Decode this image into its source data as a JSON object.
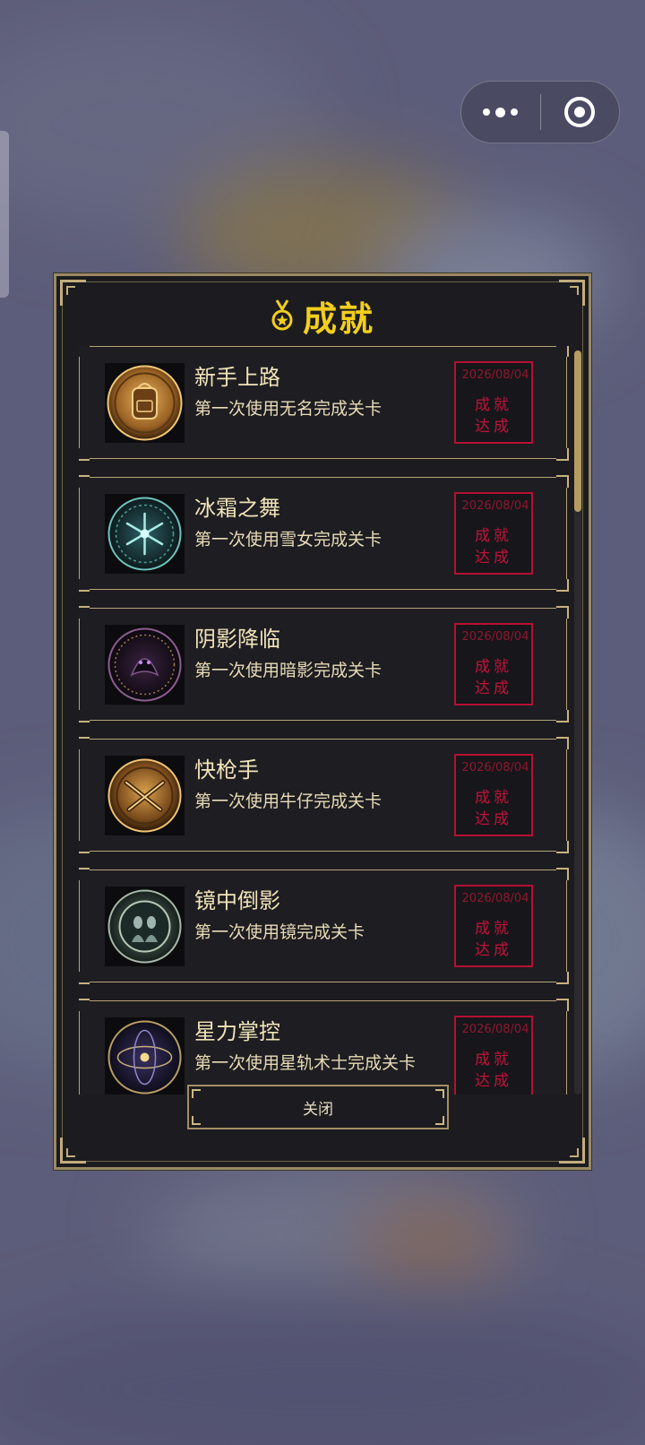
{
  "dialog": {
    "title": "成就",
    "close_label": "关闭"
  },
  "achievements": [
    {
      "name": "新手上路",
      "desc": "第一次使用无名完成关卡",
      "date": "2026/08/04",
      "stamp_line1": "成就",
      "stamp_line2": "达成",
      "badge_icon": "backpack-coin-icon"
    },
    {
      "name": "冰霜之舞",
      "desc": "第一次使用雪女完成关卡",
      "date": "2026/08/04",
      "stamp_line1": "成就",
      "stamp_line2": "达成",
      "badge_icon": "snowflake-icon"
    },
    {
      "name": "阴影降临",
      "desc": "第一次使用暗影完成关卡",
      "date": "2026/08/04",
      "stamp_line1": "成就",
      "stamp_line2": "达成",
      "badge_icon": "shadow-sigil-icon"
    },
    {
      "name": "快枪手",
      "desc": "第一次使用牛仔完成关卡",
      "date": "2026/08/04",
      "stamp_line1": "成就",
      "stamp_line2": "达成",
      "badge_icon": "crossed-pistols-icon"
    },
    {
      "name": "镜中倒影",
      "desc": "第一次使用镜完成关卡",
      "date": "2026/08/04",
      "stamp_line1": "成就",
      "stamp_line2": "达成",
      "badge_icon": "mirror-twins-icon"
    },
    {
      "name": "星力掌控",
      "desc": "第一次使用星轨术士完成关卡",
      "date": "2026/08/04",
      "stamp_line1": "成就",
      "stamp_line2": "达成",
      "badge_icon": "star-orbit-icon"
    }
  ],
  "colors": {
    "title": "#f3cf1c",
    "frame": "#b8a477",
    "stamp": "#c0143a"
  }
}
